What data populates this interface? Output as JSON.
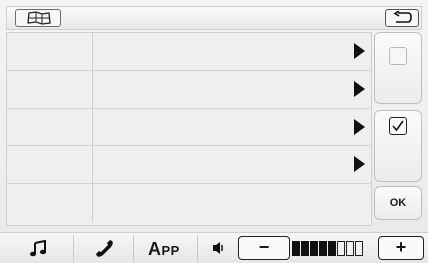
{
  "topbar": {
    "map_icon": "map-icon",
    "back_icon": "back-arrow-icon"
  },
  "list": {
    "rows": [
      {
        "label": "",
        "value": "",
        "has_arrow": true
      },
      {
        "label": "",
        "value": "",
        "has_arrow": true
      },
      {
        "label": "",
        "value": "",
        "has_arrow": true
      },
      {
        "label": "",
        "value": "",
        "has_arrow": true
      },
      {
        "label": "",
        "value": "",
        "has_arrow": false
      }
    ]
  },
  "side": {
    "checkbox_1_checked": false,
    "checkbox_2_checked": true,
    "ok_label": "OK"
  },
  "bottombar": {
    "music_icon": "music-note-icon",
    "phone_icon": "phone-handset-icon",
    "app_label_big": "A",
    "app_label_small": "PP",
    "speaker_icon": "speaker-icon",
    "minus_label": "−",
    "plus_label": "+",
    "volume_level": 5,
    "volume_max": 8
  }
}
